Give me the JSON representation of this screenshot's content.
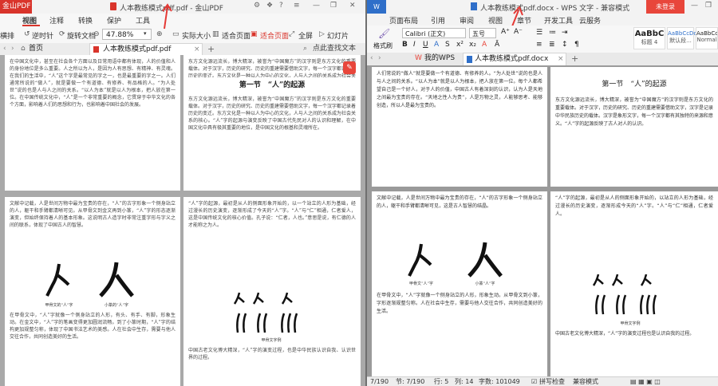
{
  "pdf": {
    "brand": "金山PDF",
    "title": "人本教练模式pdf.pdf - 金山PDF",
    "menu": [
      "视图",
      "注释",
      "转换",
      "保护",
      "工具"
    ],
    "toolbar": {
      "read_mode": "横排",
      "prev": "逆时针",
      "rotate": "旋转文档",
      "zoom": "47.88%",
      "actual": "实际大小",
      "fit_page": "适合页面",
      "fit_width": "适合页面",
      "full": "全屏",
      "slide": "幻灯片"
    },
    "tabs": {
      "home": "首页",
      "doc": "人本教练模式pdf.pdf",
      "find": "点此查找文本"
    },
    "page1": {
      "left_text": "在中国文化中，甚至在社会各个方面以及日常用语中都有体现，人的价值和人的身份地位是多么重要。人之所以为人，是因为人有思想、有精神、有灵魂。在我们的生活中，“人”这个字是最常见的字之一，也是最重要的字之一。人们通常所说的“做人”，就是要做一个有道德、有修养、有品格的人。“为人处世”说的也是人与人之间的关系。“以人为本”就是以人为根本，把人放在第一位。在中国传统文化中，“人”是一个非常重要的概念，它贯穿于中华文化的各个方面，影响着人们的思想和行为，也影响着中国社会的发展。",
      "heading": "第一节　“人”的起源",
      "right_text": "东方文化源远流长，博大精深，被誉为“中国魔方”的汉字则是东方文化的重要载体。对于汉字，历史的研究、历史的重建需要借助文字，每一个汉字都记录着历史的变迁。东方文化是一种以人为中心的文化，人与人之间的关系成为社会关系的核心。“人”字的起源与演变反映了中国古代先民对人的认识和理解，在中国文化中具有极其重要的地位，是中国文化的根基和灵魂所在。"
    },
    "page2": {
      "left_text": "文献中记载，人是世间万物中最为宝贵的存在，“人”的古字形象一个侧身站立的人，躯干和手臂都清晰可见。从甲骨文到金文再到小篆，“人”字的形态逐渐演变，但始终保持着人的基本形象。这说明古人造字时非常注重字形与字义之间的联系，体现了中国古人的智慧。",
      "cap1": "甲骨文的“人”字",
      "cap2": "小篆的“人”字",
      "left_text2": "在甲骨文中，“人”字就像一个侧身站立的人形，有头、有手、有脚，形象生动。在金文中，“人”字的笔画变得更加圆润流畅。到了小篆时期，“人”字的结构更加规整匀称，体现了中国书法艺术的美感。人在社会中生存，需要与他人交往合作，共同创造美好的生活。",
      "right_text": "“人”字的起源，最初是从人的侧面形象开始的，以一个站立的人形为基础，经过漫长的历史演变，逐渐形成了今天的“人”字。“人”与“仁”相通，仁者爱人，这是中国传统文化的核心价值。孔子说：“仁者，人也。”意思是说，有仁德的人才能称之为人。",
      "cap3": "甲骨文字例",
      "right_text2": "中国古老文化博大精深，“人”字的演变过程，也是中华民族认识自我、认识世界的过程。"
    }
  },
  "wps": {
    "brand": "金山WPS",
    "title": "人本教练模式pdf.docx - WPS 文字 - 兼容模式",
    "login": "未登录",
    "menu": [
      "页面布局",
      "引用",
      "审阅",
      "视图",
      "章节",
      "开发工具",
      "云服务"
    ],
    "ribbon": {
      "painter": "格式刷",
      "font": "Calibri (正文)",
      "size": "五号",
      "styles": [
        {
          "sample": "AaBbC",
          "name": "标题 4"
        },
        {
          "sample": "AaBbCcDd",
          "name": "默认段..."
        },
        {
          "sample": "AaBbCc",
          "name": "Normal"
        }
      ]
    },
    "tabs": {
      "mywps": "我的WPS",
      "doc": "人本教练模式pdf.docx"
    },
    "page1": {
      "left_text": "人们常说的“做人”就是要做一个有道德、有修养的人。“为人处世”说的也是人与人之间的关系。“以人为本”就是以人为根本，把人放在第一位。每个人都希望自己是一个好人，对于人的价值，中国古人有着深刻的认识，认为人是天地之间最为宝贵的存在。“天地之性人为贵”，人是万物之灵，人能够思考、能够创造，所以人是最为宝贵的。",
      "heading": "第一节　“人”的起源",
      "right_text": "东方文化源远流长，博大精深，被誉为“中国魔方”的汉字则是东方文化的重要载体。对于汉字，历史的研究、历史的重建需要借助文字，汉字是记录中华民族历史的载体。汉字是象形文字，每一个汉字都有其独特的来源和意义。“人”字的起源反映了古人对人的认识。"
    },
    "page2": {
      "left_text": "文献中记载，人是世间万物中最为宝贵的存在，“人”的古字形象一个侧身站立的人，躯干和手臂都清晰可见，这是古人智慧的结晶。",
      "cap1": "甲骨文“人”字",
      "cap2": "小篆“人”字",
      "left_text2": "在甲骨文中，“人”字就像一个侧身站立的人形，形象生动。从甲骨文到小篆，字形逐渐规整匀称。人在社会中生存，需要与他人交往合作，共同创造美好的生活。",
      "right_text": "“人”字的起源，最初是从人的侧面形象开始的，以站立的人形为基础，经过漫长的历史演变，逐渐形成今天的“人”字。“人”与“仁”相通，仁者爱人。",
      "cap3": "甲骨文字例",
      "right_text2": "中国古老文化博大精深，“人”字的演变过程也是认识自我的过程。"
    },
    "status": {
      "page": "7/190",
      "section": "节: 7/190",
      "row": "行: 5",
      "col": "列: 14",
      "words": "字数: 101049",
      "spell": "拼写检查",
      "mode": "兼容模式"
    }
  }
}
